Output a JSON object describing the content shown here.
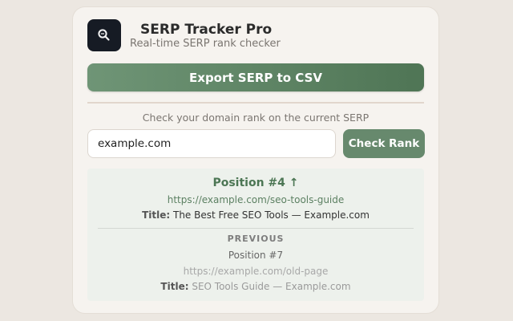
{
  "header": {
    "title": "SERP Tracker Pro",
    "subtitle": "Real-time SERP rank checker",
    "logo_icon": "magnifier-icon"
  },
  "actions": {
    "export_label": "Export SERP to CSV"
  },
  "rank_check": {
    "hint": "Check your domain rank on the current SERP",
    "domain_value": "example.com",
    "check_label": "Check Rank"
  },
  "result": {
    "current": {
      "position": "Position #4 ↑",
      "url": "https://example.com/seo-tools-guide",
      "title_label": "Title:",
      "title": "The Best Free SEO Tools — Example.com"
    },
    "previous": {
      "label": "PREVIOUS",
      "position": "Position #7",
      "url": "https://example.com/old-page",
      "title_label": "Title:",
      "title": "SEO Tools Guide — Example.com"
    }
  },
  "colors": {
    "accent": "#5f8766",
    "accent_dark": "#4c7654",
    "logo_bg": "#161b24",
    "result_bg": "#edf1ec"
  }
}
